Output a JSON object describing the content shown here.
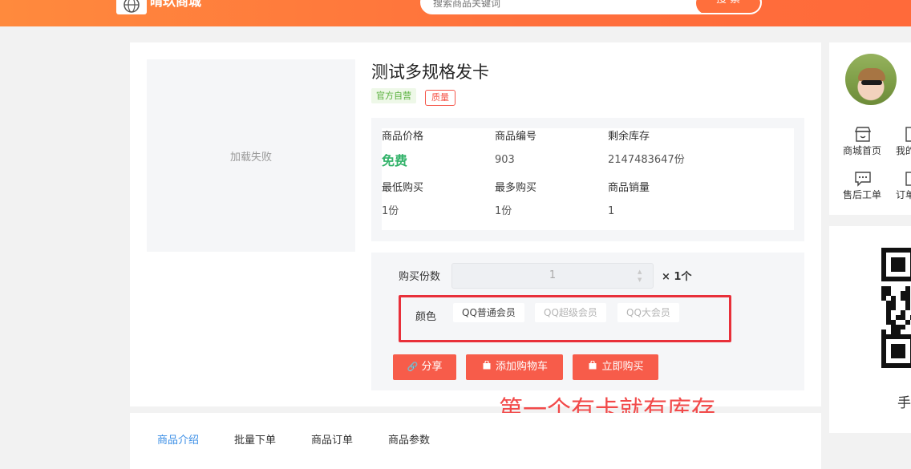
{
  "header": {
    "site_name": "晴玖商城",
    "search_placeholder": "搜索商品关键词",
    "search_button": "搜 索"
  },
  "product": {
    "image_status": "加载失败",
    "title": "测试多规格发卡",
    "tags": {
      "official": "官方自营",
      "quality": "质量"
    },
    "info": {
      "price_label": "商品价格",
      "price_value": "免费",
      "code_label": "商品编号",
      "code_value": "903",
      "stock_label": "剩余库存",
      "stock_value": "2147483647份",
      "min_label": "最低购买",
      "min_value": "1份",
      "max_label": "最多购买",
      "max_value": "1份",
      "sales_label": "商品销量",
      "sales_value": "1"
    },
    "purchase": {
      "qty_label": "购买份数",
      "qty_value": "1",
      "qty_unit": "× 1个",
      "color_label": "颜色",
      "options": [
        {
          "label": "QQ普通会员",
          "selected": true
        },
        {
          "label": "QQ超级会员",
          "selected": false
        },
        {
          "label": "QQ大会员",
          "selected": false
        }
      ]
    },
    "buttons": {
      "share": "分享",
      "add_cart": "添加购物车",
      "buy_now": "立即购买"
    }
  },
  "annotation": "第一个有卡就有库存",
  "tabs": [
    {
      "label": "商品介绍",
      "active": true
    },
    {
      "label": "批量下单",
      "active": false
    },
    {
      "label": "商品订单",
      "active": false
    },
    {
      "label": "商品参数",
      "active": false
    }
  ],
  "sidebar": {
    "menu": [
      {
        "label": "商城首页",
        "icon": "store-icon"
      },
      {
        "label": "我的",
        "icon": "user-icon"
      },
      {
        "label": "售后工单",
        "icon": "chat-icon"
      },
      {
        "label": "订单",
        "icon": "order-icon"
      }
    ],
    "qr_caption": "手"
  },
  "colors": {
    "header_orange": "#ff6f3c",
    "button_red": "#f75c4a",
    "price_green": "#34b36b",
    "tab_active": "#3a8ee6",
    "annotation_red": "#f24a4a"
  }
}
